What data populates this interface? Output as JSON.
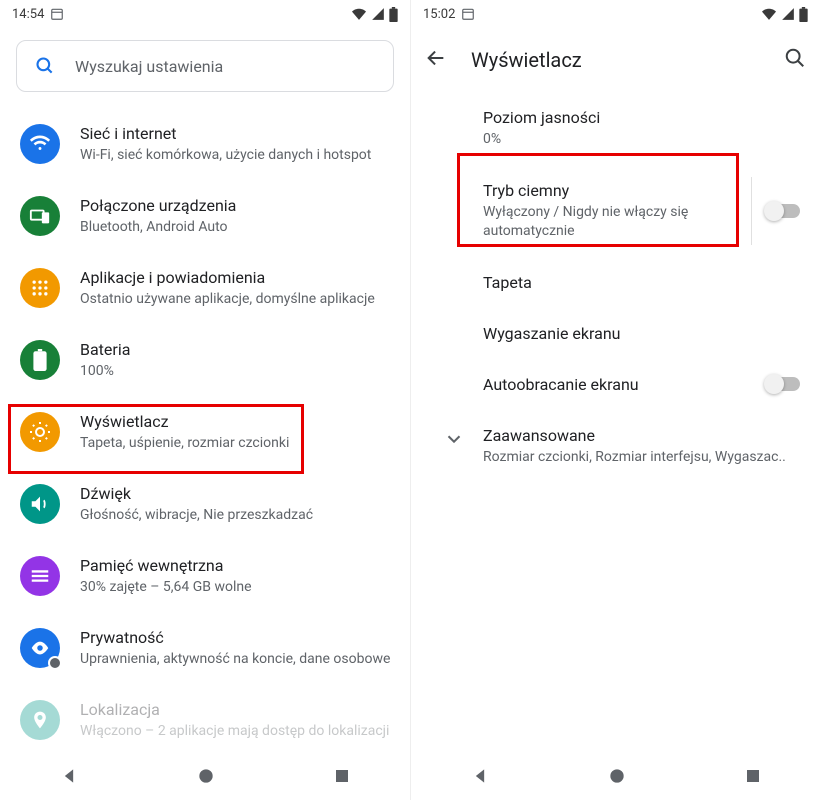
{
  "left": {
    "time": "14:54",
    "search_placeholder": "Wyszukaj ustawienia",
    "items": [
      {
        "title": "Sieć i internet",
        "sub": "Wi-Fi, sieć komórkowa, użycie danych i hotspot",
        "color": "#1a73e8",
        "icon": "wifi"
      },
      {
        "title": "Połączone urządzenia",
        "sub": "Bluetooth, Android Auto",
        "color": "#188038",
        "icon": "devices"
      },
      {
        "title": "Aplikacje i powiadomienia",
        "sub": "Ostatnio używane aplikacje, domyślne aplikacje",
        "color": "#f29900",
        "icon": "apps"
      },
      {
        "title": "Bateria",
        "sub": "100%",
        "color": "#188038",
        "icon": "battery"
      },
      {
        "title": "Wyświetlacz",
        "sub": "Tapeta, uśpienie, rozmiar czcionki",
        "color": "#f29900",
        "icon": "display"
      },
      {
        "title": "Dźwięk",
        "sub": "Głośność, wibracje, Nie przeszkadzać",
        "color": "#009688",
        "icon": "sound"
      },
      {
        "title": "Pamięć wewnętrzna",
        "sub": "30% zajęte – 5,64 GB wolne",
        "color": "#9334e6",
        "icon": "storage"
      },
      {
        "title": "Prywatność",
        "sub": "Uprawnienia, aktywność na koncie, dane osobowe",
        "color": "#1a73e8",
        "icon": "privacy"
      },
      {
        "title": "Lokalizacja",
        "sub": "Włączono – 2 aplikacje mają dostęp do lokalizacji",
        "color": "#009688",
        "icon": "location"
      }
    ]
  },
  "right": {
    "time": "15:02",
    "header": "Wyświetlacz",
    "items": [
      {
        "title": "Poziom jasności",
        "sub": "0%"
      },
      {
        "title": "Tryb ciemny",
        "sub": "Wyłączony / Nigdy nie włączy się automatycznie",
        "switch": true
      },
      {
        "title": "Tapeta"
      },
      {
        "title": "Wygaszanie ekranu"
      },
      {
        "title": "Autoobracanie ekranu",
        "switch": true
      }
    ],
    "advanced": {
      "title": "Zaawansowane",
      "sub": "Rozmiar czcionki, Rozmiar interfejsu, Wygaszac.."
    }
  }
}
